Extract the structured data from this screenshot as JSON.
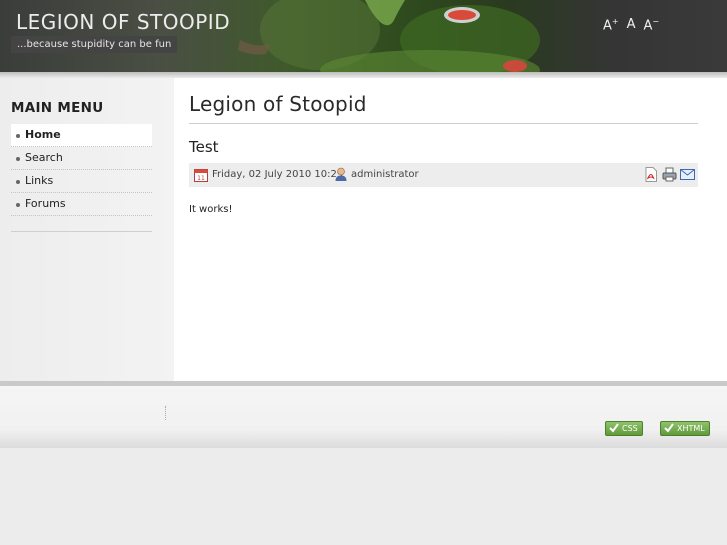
{
  "header": {
    "site_title": "LEGION OF STOOPID",
    "tagline": "...because stupidity can be fun",
    "font_controls": [
      "A+",
      "A",
      "A-"
    ]
  },
  "sidebar": {
    "title": "MAIN MENU",
    "items": [
      {
        "label": "Home",
        "active": true
      },
      {
        "label": "Search",
        "active": false
      },
      {
        "label": "Links",
        "active": false
      },
      {
        "label": "Forums",
        "active": false
      }
    ]
  },
  "main": {
    "page_title": "Legion of Stoopid",
    "article": {
      "title": "Test",
      "date": "Friday, 02 July 2010 10:29",
      "author": "administrator",
      "body": "It works!",
      "icons": [
        "calendar-icon",
        "user-icon",
        "pdf-icon",
        "print-icon",
        "email-icon"
      ]
    }
  },
  "footer": {
    "badges": [
      "CSS",
      "XHTML"
    ]
  }
}
